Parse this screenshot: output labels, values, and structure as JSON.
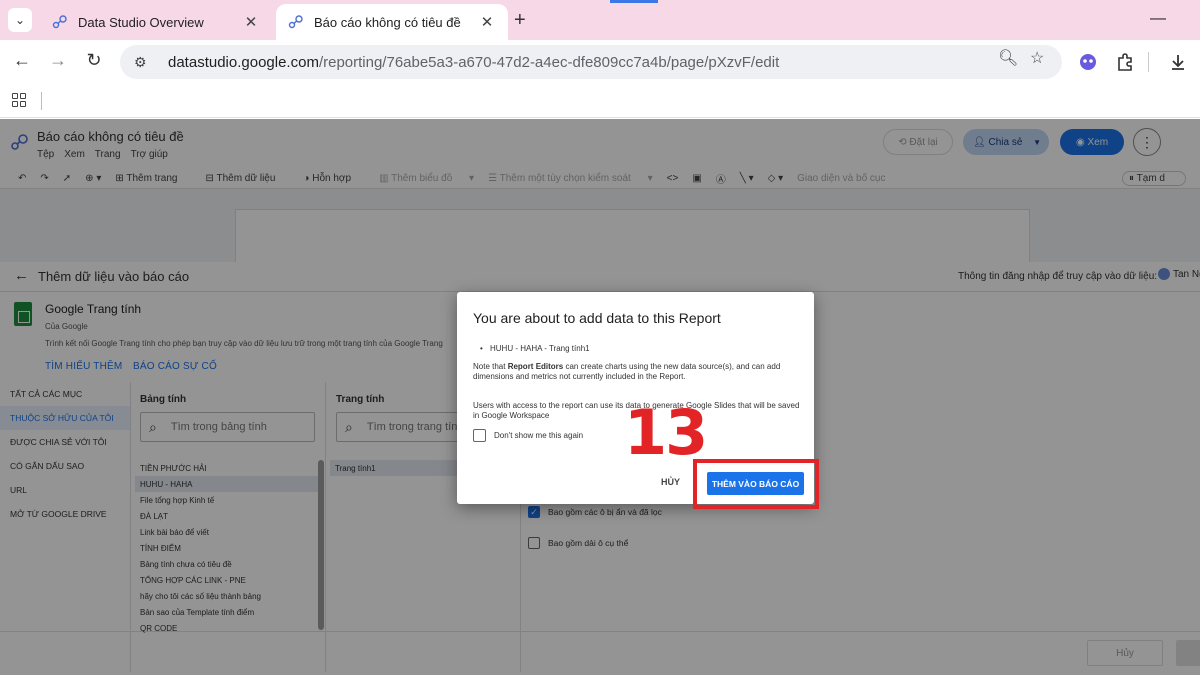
{
  "browser": {
    "tabs": [
      {
        "title": "Data Studio Overview",
        "close": "✕"
      },
      {
        "title": "Báo cáo không có tiêu đề",
        "close": "✕"
      }
    ],
    "new_tab": "+",
    "minimize": "—",
    "url_host": "datastudio.google.com",
    "url_path": "/reporting/76abe5a3-a670-47d2-a4ec-dfe809cc7a4b/page/pXzvF/edit"
  },
  "app": {
    "report_title": "Báo cáo không có tiêu đề",
    "menu": [
      "Tệp",
      "Xem",
      "Trang",
      "Trợ giúp"
    ],
    "reset_label": "Đặt lại",
    "share_label": "Chia sẻ",
    "view_label": "Xem",
    "toolbar": {
      "add_page": "Thêm trang",
      "add_data": "Thêm dữ liệu",
      "blend": "Hỗn hợp",
      "add_chart": "Thêm biểu đồ",
      "add_control": "Thêm một tùy chọn kiểm soát",
      "theme": "Giao diện và bố cục",
      "pause": "Tạm d"
    }
  },
  "panel": {
    "title": "Thêm dữ liệu vào báo cáo",
    "credentials_text": "Thông tin đăng nhập để truy cập vào dữ liệu:",
    "credentials_user": "Tan Ng",
    "connector_name": "Google Trang tính",
    "connector_by": "Của Google",
    "connector_desc": "Trình kết nối Google Trang tính cho phép bạn truy cập vào dữ liệu lưu trữ trong một trang tính của Google Trang",
    "learn_more": "TÌM HIỂU THÊM",
    "report_issue": "BÁO CÁO SỰ CỐ",
    "nav": [
      "TẤT CẢ CÁC MỤC",
      "THUỘC SỞ HỮU CỦA TÔI",
      "ĐƯỢC CHIA SẺ VỚI TÔI",
      "CÓ GẮN DẤU SAO",
      "URL",
      "MỞ TỪ GOOGLE DRIVE"
    ],
    "spreadsheet_header": "Bảng tính",
    "spreadsheet_search_placeholder": "Tìm trong bảng tính",
    "sheet_header": "Trang tính",
    "sheet_search_placeholder": "Tìm trong trang tính",
    "spreadsheets": [
      "TIỀN PHƯỚC HẢI",
      "HUHU - HAHA",
      "File tổng hợp Kinh tế",
      "ĐÀ LẠT",
      "Link bài báo để viết",
      "TÍNH ĐIỂM",
      "Bảng tính chưa có tiêu đề",
      "TỔNG HỢP CÁC LINK - PNE",
      "hãy cho tôi các số liệu thành bảng",
      "Bản sao của Template tính điểm",
      "QR CODE"
    ],
    "selected_sheet": "Trang tính1",
    "option_hidden": "Bao gồm các ô bị ẩn và đã lọc",
    "option_range": "Bao gồm dải ô cụ thể",
    "footer_cancel": "Hủy"
  },
  "dialog": {
    "title": "You are about to add data to this Report",
    "source": "HUHU - HAHA - Trang tính1",
    "note_prefix": "Note that ",
    "note_bold": "Report Editors",
    "note_rest": " can create charts using the new data source(s), and can add dimensions and metrics not currently included in the Report.",
    "note2": "Users with access to the report can use its data to generate Google Slides that will be saved in Google Workspace",
    "checkbox_label": "Don't show me this again",
    "cancel_label": "HỦY",
    "add_label": "THÊM VÀO BÁO CÁO"
  },
  "annotation": {
    "step_number": "13",
    "color": "#e32426"
  }
}
